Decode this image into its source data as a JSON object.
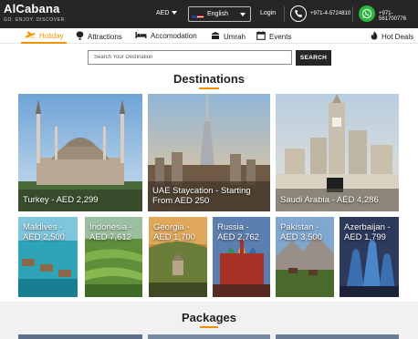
{
  "header": {
    "brand": "AlCabana",
    "tagline": "GO. ENJOY. DISCOVER.",
    "currency": "AED",
    "language": "English",
    "login": "Login",
    "phone": "+971-4-5724810",
    "whatsapp": "+971-561700776"
  },
  "nav": {
    "items": [
      {
        "label": "Holiday",
        "icon": "plane-icon",
        "active": true
      },
      {
        "label": "Attractions",
        "icon": "balloon-icon"
      },
      {
        "label": "Accomodation",
        "icon": "bed-icon"
      },
      {
        "label": "Umrah",
        "icon": "kaaba-icon"
      },
      {
        "label": "Events",
        "icon": "calendar-icon"
      }
    ],
    "hot_deals": "Hot Deals"
  },
  "search": {
    "placeholder": "Search Your Destination",
    "button": "SEARCH"
  },
  "destinations": {
    "title": "Destinations",
    "featured": [
      {
        "label": "Turkey - AED 2,299"
      },
      {
        "label": "UAE Staycation - Starting From AED 250"
      },
      {
        "label": "Saudi Arabia - AED 4,286"
      }
    ],
    "grid": [
      {
        "line1": "Maldives -",
        "line2": "AED 2,500"
      },
      {
        "line1": "Indonesia -",
        "line2": "AED 7,612"
      },
      {
        "line1": "Georgia -",
        "line2": "AED 1,700"
      },
      {
        "line1": "Russia -",
        "line2": "AED 2,762"
      },
      {
        "line1": "Pakistan -",
        "line2": "AED 3,500"
      },
      {
        "line1": "Azerbaijan -",
        "line2": "AED 1,799"
      }
    ]
  },
  "packages": {
    "title": "Packages"
  },
  "colors": {
    "accent": "#f39200",
    "topbar": "#262626",
    "whatsapp": "#2bb741"
  }
}
